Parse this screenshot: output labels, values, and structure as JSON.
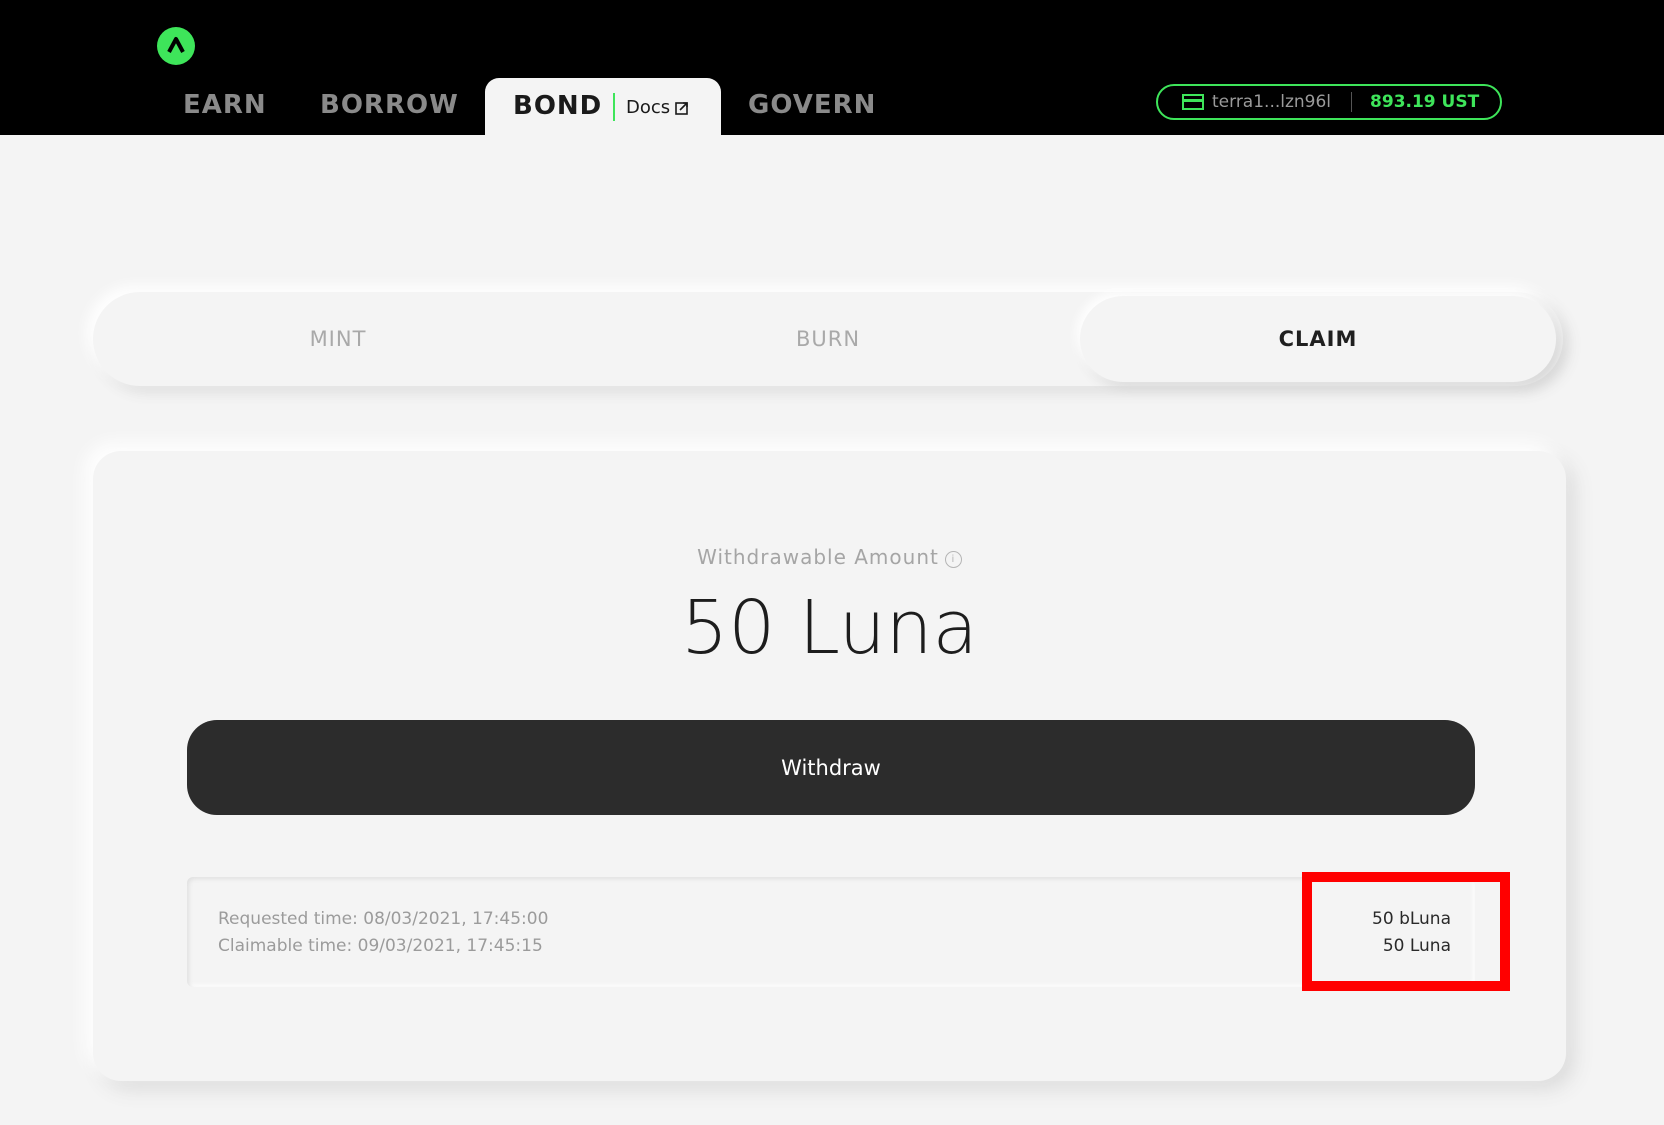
{
  "nav": {
    "items": [
      {
        "label": "EARN"
      },
      {
        "label": "BORROW"
      },
      {
        "label": "BOND"
      },
      {
        "label": "GOVERN"
      }
    ],
    "docs_label": "Docs",
    "logo_icon": "anchor-logo-icon"
  },
  "wallet": {
    "address": "terra1...lzn96l",
    "balance": "893.19 UST",
    "icon": "wallet-icon"
  },
  "tabs": [
    {
      "label": "MINT"
    },
    {
      "label": "BURN"
    },
    {
      "label": "CLAIM"
    }
  ],
  "claim": {
    "label": "Withdrawable Amount",
    "amount": "50 Luna",
    "button_label": "Withdraw",
    "request": {
      "requested_time": "Requested time: 08/03/2021, 17:45:00",
      "claimable_time": "Claimable time: 09/03/2021, 17:45:15",
      "bluna_amount": "50 bLuna",
      "luna_amount": "50 Luna"
    }
  },
  "colors": {
    "accent": "#3ee55a",
    "highlight": "#ff0000",
    "button": "#2c2c2c"
  }
}
